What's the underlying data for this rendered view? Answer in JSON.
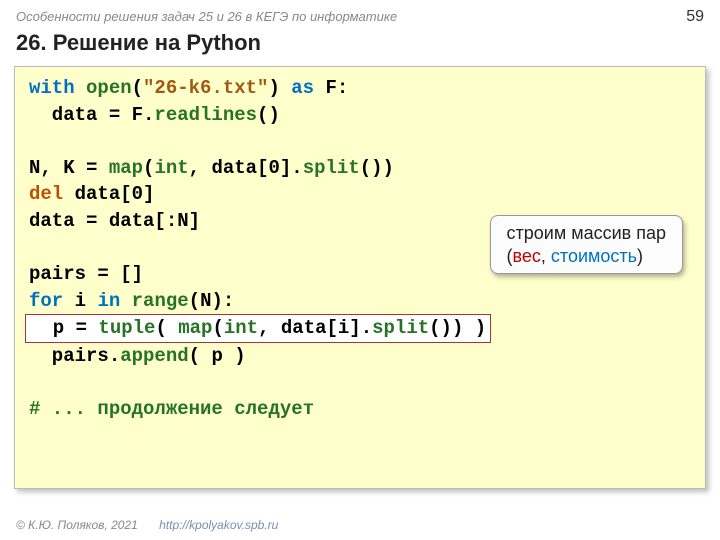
{
  "meta": {
    "top_title": "Особенности решения задач 25 и 26 в КЕГЭ по информатике",
    "page_number": "59",
    "heading": "26. Решение на Python"
  },
  "code": {
    "l1_with": "with",
    "l1_open": "open",
    "l1_str": "\"26-k6.txt\"",
    "l1_as": "as",
    "l1_rest": " F:",
    "l2_a": "  data = F.",
    "l2_fn": "readlines",
    "l2_b": "()",
    "l3": "",
    "l4_a": "N, K = ",
    "l4_map": "map",
    "l4_b": "(",
    "l4_int": "int",
    "l4_c": ", data[0].",
    "l4_split": "split",
    "l4_d": "())",
    "l5_del": "del",
    "l5_rest": " data[0]",
    "l6": "data = data[:N]",
    "l7": "",
    "l8": "pairs = []",
    "l9_for": "for",
    "l9_a": " i ",
    "l9_in": "in",
    "l9_b": " ",
    "l9_range": "range",
    "l9_c": "(N):",
    "l10_a": "  p = ",
    "l10_tuple": "tuple",
    "l10_b": "( ",
    "l10_map": "map",
    "l10_c": "(",
    "l10_int": "int",
    "l10_d": ", data[i].",
    "l10_split": "split",
    "l10_e": "()) )",
    "l11_a": "  pairs.",
    "l11_fn": "append",
    "l11_b": "( p )",
    "l12": "",
    "l13": "# ... продолжение следует"
  },
  "callout": {
    "line1": "строим массив пар",
    "paren_open": "(",
    "w1": "вес",
    "comma": ", ",
    "w2": "стоимость",
    "paren_close": ")"
  },
  "footer": {
    "copyright": "© К.Ю. Поляков, 2021",
    "url": "http://kpolyakov.spb.ru"
  }
}
